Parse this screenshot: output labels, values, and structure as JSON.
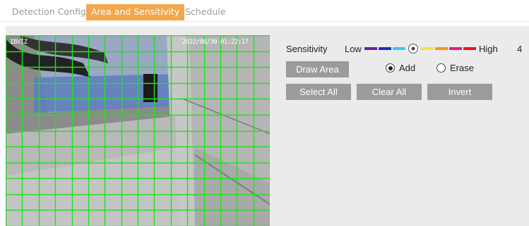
{
  "tabs": [
    {
      "label": "Detection Config"
    },
    {
      "label": "Area and Sensitivity"
    },
    {
      "label": "Schedule"
    }
  ],
  "video": {
    "osd_left": "IBVIZ",
    "osd_right": "2022/06/30 01:22:17"
  },
  "sensitivity": {
    "label": "Sensitivity",
    "low_label": "Low",
    "high_label": "High",
    "value": "4",
    "level": 4,
    "max_level": 8,
    "segment_colors": [
      "#6b1f9e",
      "#1a2fcf",
      "#37c8e9",
      "#ffffff",
      "#f2e43a",
      "#f7941d",
      "#e3207c",
      "#e8151c"
    ]
  },
  "buttons": {
    "draw_area": "Draw Area",
    "select_all": "Select All",
    "clear_all": "Clear All",
    "invert": "Invert"
  },
  "mode": {
    "add_label": "Add",
    "erase_label": "Erase",
    "selected": "add"
  },
  "colors": {
    "active_tab": "#f4a64a",
    "grid_line": "#22e022",
    "button": "#9b9b9b"
  }
}
